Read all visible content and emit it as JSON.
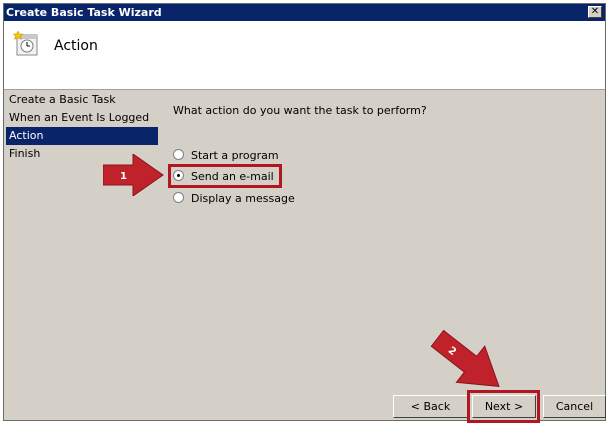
{
  "window": {
    "title": "Create Basic Task Wizard",
    "close_glyph": "✕"
  },
  "header": {
    "title": "Action",
    "icon": "task-scheduler-icon"
  },
  "steps": [
    {
      "label": "Create a Basic Task"
    },
    {
      "label": "When an Event Is Logged"
    },
    {
      "label": "Action"
    },
    {
      "label": "Finish"
    }
  ],
  "active_step": "Action",
  "question": "What action do you want the task to perform?",
  "options": [
    {
      "label": "Start a program",
      "checked": false
    },
    {
      "label": "Send an e-mail",
      "checked": true
    },
    {
      "label": "Display a message",
      "checked": false
    }
  ],
  "annotations": {
    "arrow1_label": "1",
    "arrow2_label": "2",
    "color": "#b01722"
  },
  "buttons": {
    "back": "< Back",
    "next": "Next >",
    "cancel": "Cancel"
  }
}
